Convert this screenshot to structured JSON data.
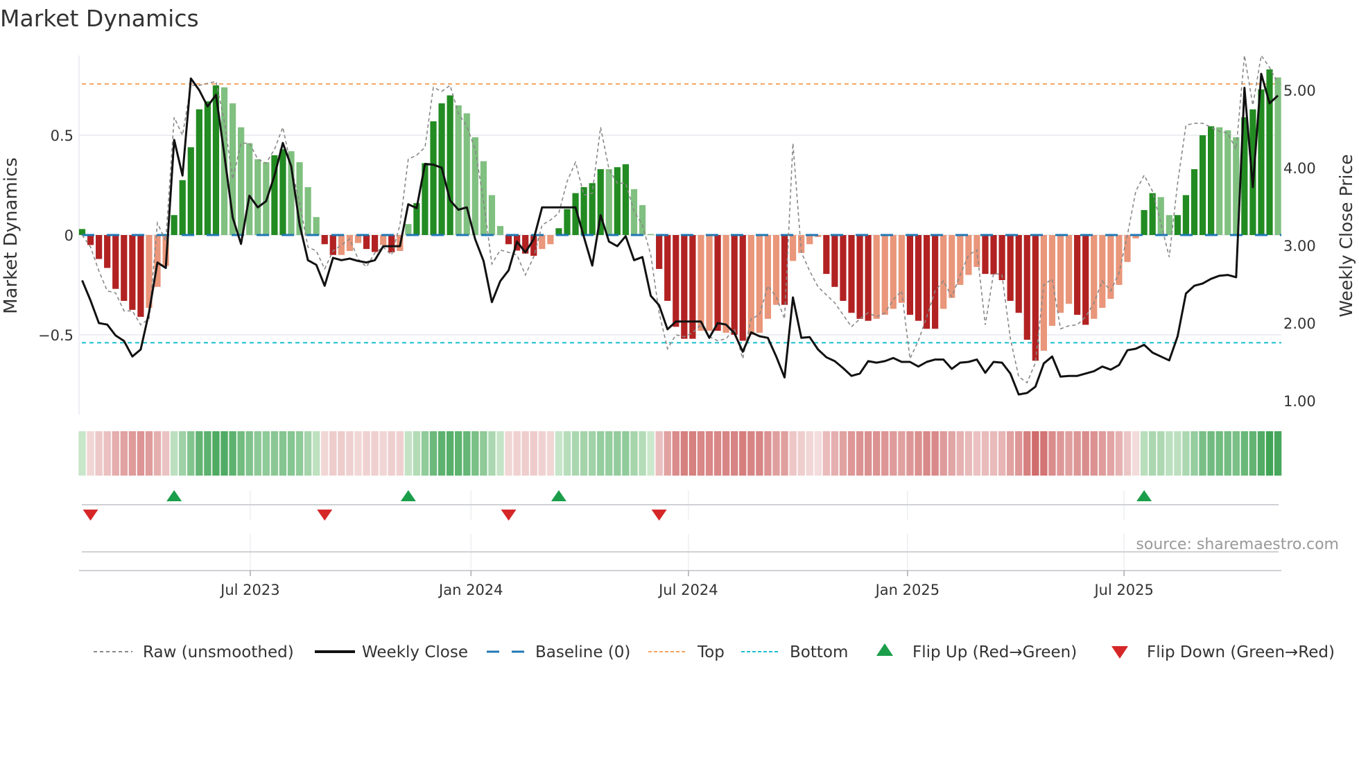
{
  "title": "Market Dynamics",
  "source": "source: sharemaestro.com",
  "chart_data": {
    "type": "bar",
    "title": "Market Dynamics",
    "ylabel": "Market Dynamics",
    "y2label": "Weekly Close Price",
    "ylim": [
      -0.9,
      0.9
    ],
    "y2lim": [
      0.82,
      5.45
    ],
    "yticks": [
      {
        "v": 0.5,
        "label": "0.5"
      },
      {
        "v": 0,
        "label": "0"
      },
      {
        "v": -0.5,
        "label": "−0.5"
      }
    ],
    "y2ticks": [
      {
        "v": 5,
        "label": "5.00"
      },
      {
        "v": 4,
        "label": "4.00"
      },
      {
        "v": 3,
        "label": "3.00"
      },
      {
        "v": 2,
        "label": "2.00"
      },
      {
        "v": 1,
        "label": "1.00"
      }
    ],
    "x_unit": "week index",
    "xticks": [
      {
        "week": 20.1,
        "label": "Jul 2023"
      },
      {
        "week": 46.5,
        "label": "Jan 2024"
      },
      {
        "week": 72.5,
        "label": "Jul 2024"
      },
      {
        "week": 98.7,
        "label": "Jan 2025"
      },
      {
        "week": 124.6,
        "label": "Jul 2025"
      }
    ],
    "top_level": 0.757,
    "bottom_level": -0.54,
    "baseline": 0,
    "momentum": [
      0.03,
      -0.05,
      -0.12,
      -0.165,
      -0.27,
      -0.33,
      -0.375,
      -0.41,
      -0.365,
      -0.26,
      -0.155,
      0.1,
      0.275,
      0.44,
      0.63,
      0.67,
      0.75,
      0.74,
      0.66,
      0.54,
      0.46,
      0.38,
      0.365,
      0.4,
      0.43,
      0.42,
      0.365,
      0.24,
      0.09,
      -0.046,
      -0.1,
      -0.1,
      -0.08,
      -0.04,
      -0.07,
      -0.085,
      -0.05,
      -0.087,
      -0.08,
      0.055,
      0.16,
      0.36,
      0.57,
      0.66,
      0.7,
      0.65,
      0.61,
      0.49,
      0.37,
      0.2,
      0.045,
      -0.046,
      -0.078,
      -0.093,
      -0.104,
      -0.07,
      -0.046,
      0.034,
      0.13,
      0.21,
      0.24,
      0.26,
      0.33,
      0.33,
      0.34,
      0.355,
      0.23,
      0.15,
      0.005,
      -0.17,
      -0.33,
      -0.46,
      -0.52,
      -0.52,
      -0.48,
      -0.48,
      -0.48,
      -0.49,
      -0.5,
      -0.53,
      -0.5,
      -0.49,
      -0.42,
      -0.35,
      -0.35,
      -0.13,
      -0.09,
      -0.046,
      -0.01,
      -0.195,
      -0.26,
      -0.33,
      -0.39,
      -0.42,
      -0.43,
      -0.42,
      -0.4,
      -0.37,
      -0.34,
      -0.4,
      -0.43,
      -0.47,
      -0.47,
      -0.37,
      -0.315,
      -0.25,
      -0.2,
      -0.16,
      -0.195,
      -0.197,
      -0.226,
      -0.33,
      -0.39,
      -0.525,
      -0.63,
      -0.58,
      -0.455,
      -0.39,
      -0.345,
      -0.4,
      -0.45,
      -0.42,
      -0.365,
      -0.32,
      -0.25,
      -0.135,
      -0.017,
      0.125,
      0.21,
      0.19,
      0.1,
      0.1,
      0.2,
      0.33,
      0.5,
      0.545,
      0.54,
      0.525,
      0.49,
      0.59,
      0.63,
      0.73,
      0.83,
      0.79
    ],
    "strength": "111111110001111110000001100001100011010011111000000111100111111011000111110010110000100001111110000111100000111111100001100000011001111100011110",
    "raw": [
      0.0,
      -0.06,
      -0.18,
      -0.28,
      -0.29,
      -0.38,
      -0.38,
      -0.45,
      -0.42,
      0.06,
      -0.03,
      0.59,
      0.5,
      0.75,
      0.75,
      0.76,
      0.77,
      0.57,
      0.28,
      0.46,
      0.46,
      0.38,
      0.36,
      0.43,
      0.54,
      0.34,
      0.16,
      -0.06,
      -0.08,
      -0.17,
      -0.08,
      -0.05,
      -0.02,
      -0.12,
      -0.16,
      -0.09,
      -0.06,
      -0.1,
      0.05,
      0.38,
      0.4,
      0.44,
      0.74,
      0.72,
      0.75,
      0.61,
      0.545,
      0.43,
      0.17,
      -0.145,
      -0.075,
      -0.087,
      -0.1,
      -0.2,
      -0.11,
      0.05,
      0.075,
      0.11,
      0.27,
      0.365,
      0.2,
      0.21,
      0.54,
      0.33,
      0.26,
      0.26,
      0.12,
      0.05,
      -0.1,
      -0.39,
      -0.57,
      -0.5,
      -0.51,
      -0.49,
      -0.45,
      -0.51,
      -0.53,
      -0.52,
      -0.47,
      -0.62,
      -0.42,
      -0.4,
      -0.255,
      -0.31,
      -0.42,
      0.46,
      -0.087,
      -0.18,
      -0.26,
      -0.3,
      -0.34,
      -0.4,
      -0.46,
      -0.42,
      -0.39,
      -0.41,
      -0.39,
      -0.325,
      -0.28,
      -0.62,
      -0.53,
      -0.41,
      -0.28,
      -0.23,
      -0.31,
      -0.2,
      -0.1,
      -0.075,
      -0.45,
      -0.19,
      -0.2,
      -0.52,
      -0.71,
      -0.74,
      -0.64,
      -0.25,
      -0.22,
      -0.47,
      -0.455,
      -0.45,
      -0.41,
      -0.34,
      -0.23,
      -0.28,
      -0.19,
      0.0,
      0.22,
      0.3,
      0.22,
      0.06,
      -0.11,
      0.26,
      0.55,
      0.56,
      0.56,
      0.54,
      0.52,
      0.51,
      0.43,
      0.9,
      0.65,
      0.9,
      0.84,
      0.76
    ],
    "weekly_close": [
      2.55,
      2.29,
      2.0,
      1.98,
      1.84,
      1.77,
      1.57,
      1.66,
      2.14,
      2.78,
      2.71,
      4.36,
      3.9,
      5.15,
      5.0,
      4.79,
      4.94,
      4.17,
      3.36,
      3.02,
      3.64,
      3.49,
      3.57,
      3.9,
      4.32,
      4.02,
      3.27,
      2.81,
      2.75,
      2.48,
      2.84,
      2.81,
      2.83,
      2.8,
      2.78,
      2.81,
      2.99,
      2.99,
      2.99,
      3.53,
      3.48,
      4.05,
      4.04,
      4.0,
      3.58,
      3.46,
      3.49,
      3.08,
      2.8,
      2.27,
      2.54,
      2.68,
      3.05,
      2.91,
      3.08,
      3.49,
      3.49,
      3.49,
      3.49,
      3.49,
      3.11,
      2.74,
      3.39,
      3.05,
      2.99,
      3.12,
      2.81,
      2.85,
      2.35,
      2.23,
      1.92,
      2.02,
      2.02,
      2.02,
      2.02,
      1.81,
      2.0,
      1.98,
      1.87,
      1.63,
      1.88,
      1.83,
      1.81,
      1.57,
      1.3,
      2.33,
      1.81,
      1.82,
      1.66,
      1.56,
      1.51,
      1.42,
      1.32,
      1.35,
      1.51,
      1.49,
      1.51,
      1.55,
      1.5,
      1.5,
      1.44,
      1.5,
      1.53,
      1.53,
      1.41,
      1.49,
      1.5,
      1.53,
      1.36,
      1.5,
      1.49,
      1.35,
      1.08,
      1.1,
      1.18,
      1.48,
      1.57,
      1.31,
      1.32,
      1.32,
      1.35,
      1.38,
      1.44,
      1.4,
      1.46,
      1.65,
      1.67,
      1.72,
      1.62,
      1.57,
      1.52,
      1.83,
      2.38,
      2.48,
      2.51,
      2.57,
      2.61,
      2.62,
      2.59,
      5.03,
      3.75,
      5.21,
      4.83,
      4.93
    ],
    "flip_up": [
      11,
      39,
      57,
      127
    ],
    "flip_down": [
      1,
      29,
      51,
      69
    ],
    "colors": {
      "strong_green": "#228b22",
      "weak_green": "#80c080",
      "strong_red": "#b22222",
      "weak_red": "#e9967a",
      "raw": "#888888",
      "close": "#111111",
      "baseline": "#1f77b4",
      "top": "#f4a460",
      "bottom": "#17becf",
      "flip_up": "#1a9e4a",
      "flip_down": "#d62728"
    },
    "legend": {
      "placement": "bottom",
      "items": [
        {
          "label": "Raw (unsmoothed)",
          "kind": "raw"
        },
        {
          "label": "Weekly Close",
          "kind": "close"
        },
        {
          "label": "Baseline (0)",
          "kind": "baseline"
        },
        {
          "label": "Top",
          "kind": "top"
        },
        {
          "label": "Bottom",
          "kind": "bottom"
        },
        {
          "label": "Flip Up (Red→Green)",
          "kind": "flip_up"
        },
        {
          "label": "Flip Down (Green→Red)",
          "kind": "flip_down"
        }
      ]
    }
  }
}
